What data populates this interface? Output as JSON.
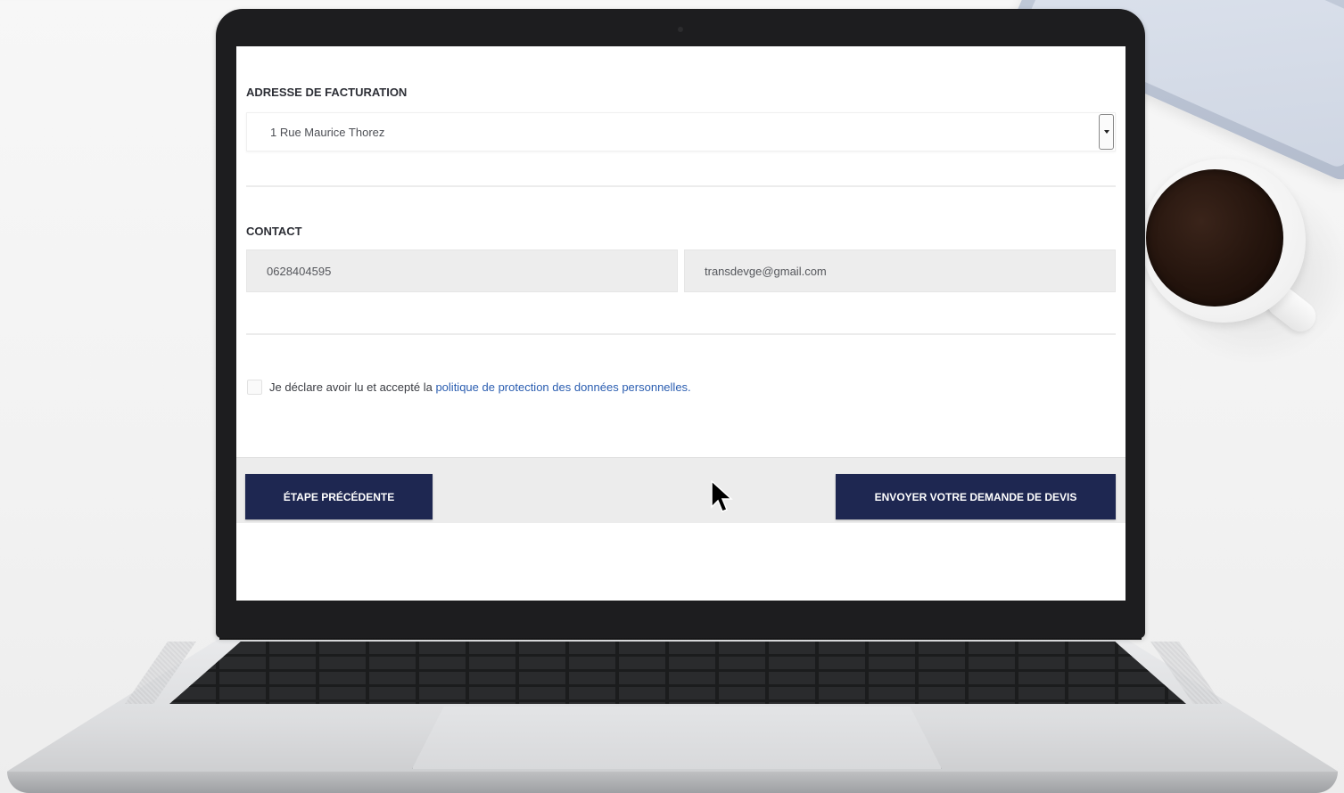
{
  "billing": {
    "section_title": "ADRESSE DE FACTURATION",
    "address_selected": "1 Rue Maurice Thorez"
  },
  "contact": {
    "section_title": "CONTACT",
    "phone_value": "0628404595",
    "email_value": "transdevge@gmail.com"
  },
  "consent": {
    "text": "Je déclare avoir lu et accepté la",
    "link_text": "politique de protection des données personnelles.",
    "checked": false
  },
  "actions": {
    "previous_label": "ÉTAPE PRÉCÉDENTE",
    "submit_label": "ENVOYER VOTRE DEMANDE DE DEVIS"
  },
  "colors": {
    "button_bg": "#1e2751",
    "link": "#2a5db0",
    "input_bg": "#ededed"
  },
  "icons": {
    "select_arrow": "chevron-down-icon",
    "pointer": "mouse-cursor-icon"
  }
}
